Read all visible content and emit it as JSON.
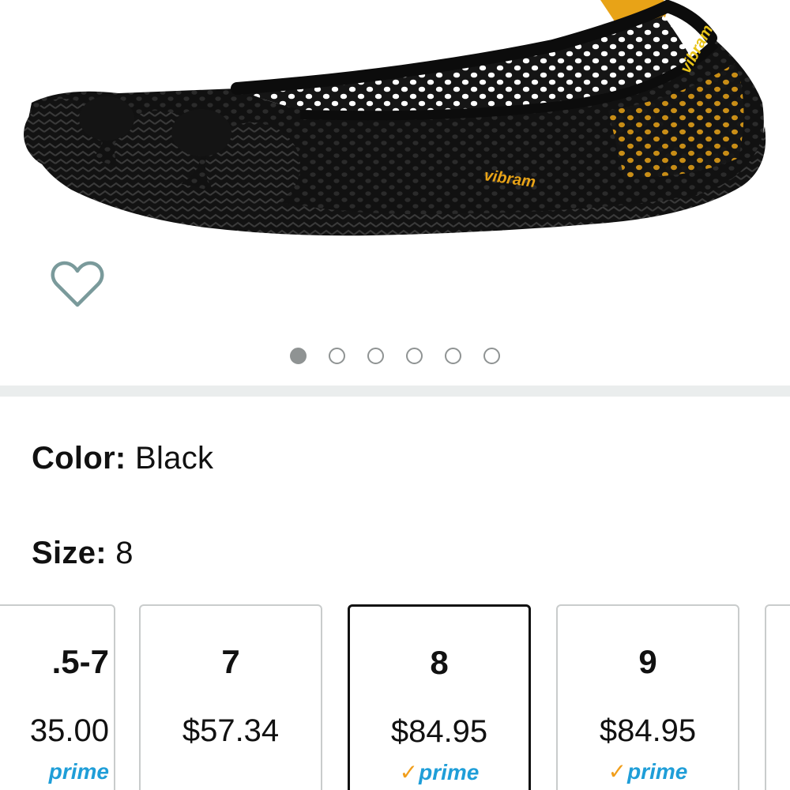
{
  "product": {
    "image_alt": "Vibram black mesh ballet flat shoe",
    "brand_mark": "vibram",
    "colors": {
      "shoe": "#141414",
      "accent": "#e8a317",
      "mesh_gap": "#ffffff"
    }
  },
  "carousel": {
    "dot_count": 6,
    "active_index": 0,
    "dot_color": "#8f9393"
  },
  "wishlist": {
    "icon": "heart-outline-icon",
    "color": "#7a9a9b"
  },
  "variations": {
    "color_label": "Color:",
    "color_value": "Black",
    "size_label": "Size:",
    "size_value": "8"
  },
  "size_options": [
    {
      "size": ".5-7",
      "price": "35.00",
      "prime_check": "",
      "prime_word": "prime",
      "selected": false
    },
    {
      "size": "7",
      "price": "$57.34",
      "prime_check": "",
      "prime_word": "",
      "selected": false
    },
    {
      "size": "8",
      "price": "$84.95",
      "prime_check": "✓",
      "prime_word": "prime",
      "selected": true
    },
    {
      "size": "9",
      "price": "$84.95",
      "prime_check": "✓",
      "prime_word": "prime",
      "selected": false
    },
    {
      "size": "",
      "price": "",
      "prime_check": "",
      "prime_word": "",
      "selected": false
    }
  ]
}
